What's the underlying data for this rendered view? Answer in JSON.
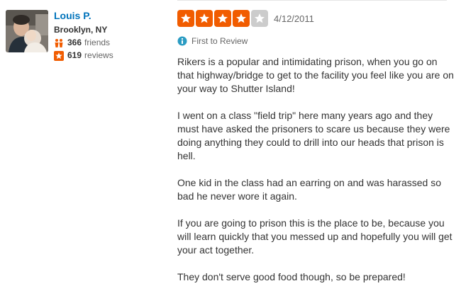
{
  "user": {
    "name": "Louis P.",
    "location": "Brooklyn, NY",
    "friends_count": "366",
    "friends_label": "friends",
    "reviews_count": "619",
    "reviews_label": "reviews"
  },
  "review": {
    "rating": 4,
    "max_rating": 5,
    "date": "4/12/2011",
    "badge": "First to Review",
    "paragraphs": [
      "Rikers is a popular and intimidating prison, when you go on that highway/bridge to get to the facility you feel like you are on your way to Shutter Island!",
      "I went on a class \"field trip\" here many years ago and they must have asked the prisoners to scare us because they were doing anything they could to drill into our heads that prison is hell.",
      "One kid in the class had an earring on and was harassed so bad he never wore it again.",
      "If you are going to prison this is the place to be, because you will learn quickly that you messed up and hopefully you will get your act together.",
      "They don't serve good food though, so be prepared!"
    ]
  },
  "colors": {
    "star_on": "#f15c00",
    "star_off": "#cccccc",
    "name_link": "#0073bb",
    "badge": "#2b9cc3"
  },
  "icons": {
    "friends": "friends-icon",
    "reviews": "review-star-icon",
    "badge": "first-to-review-icon",
    "star": "star-icon"
  }
}
